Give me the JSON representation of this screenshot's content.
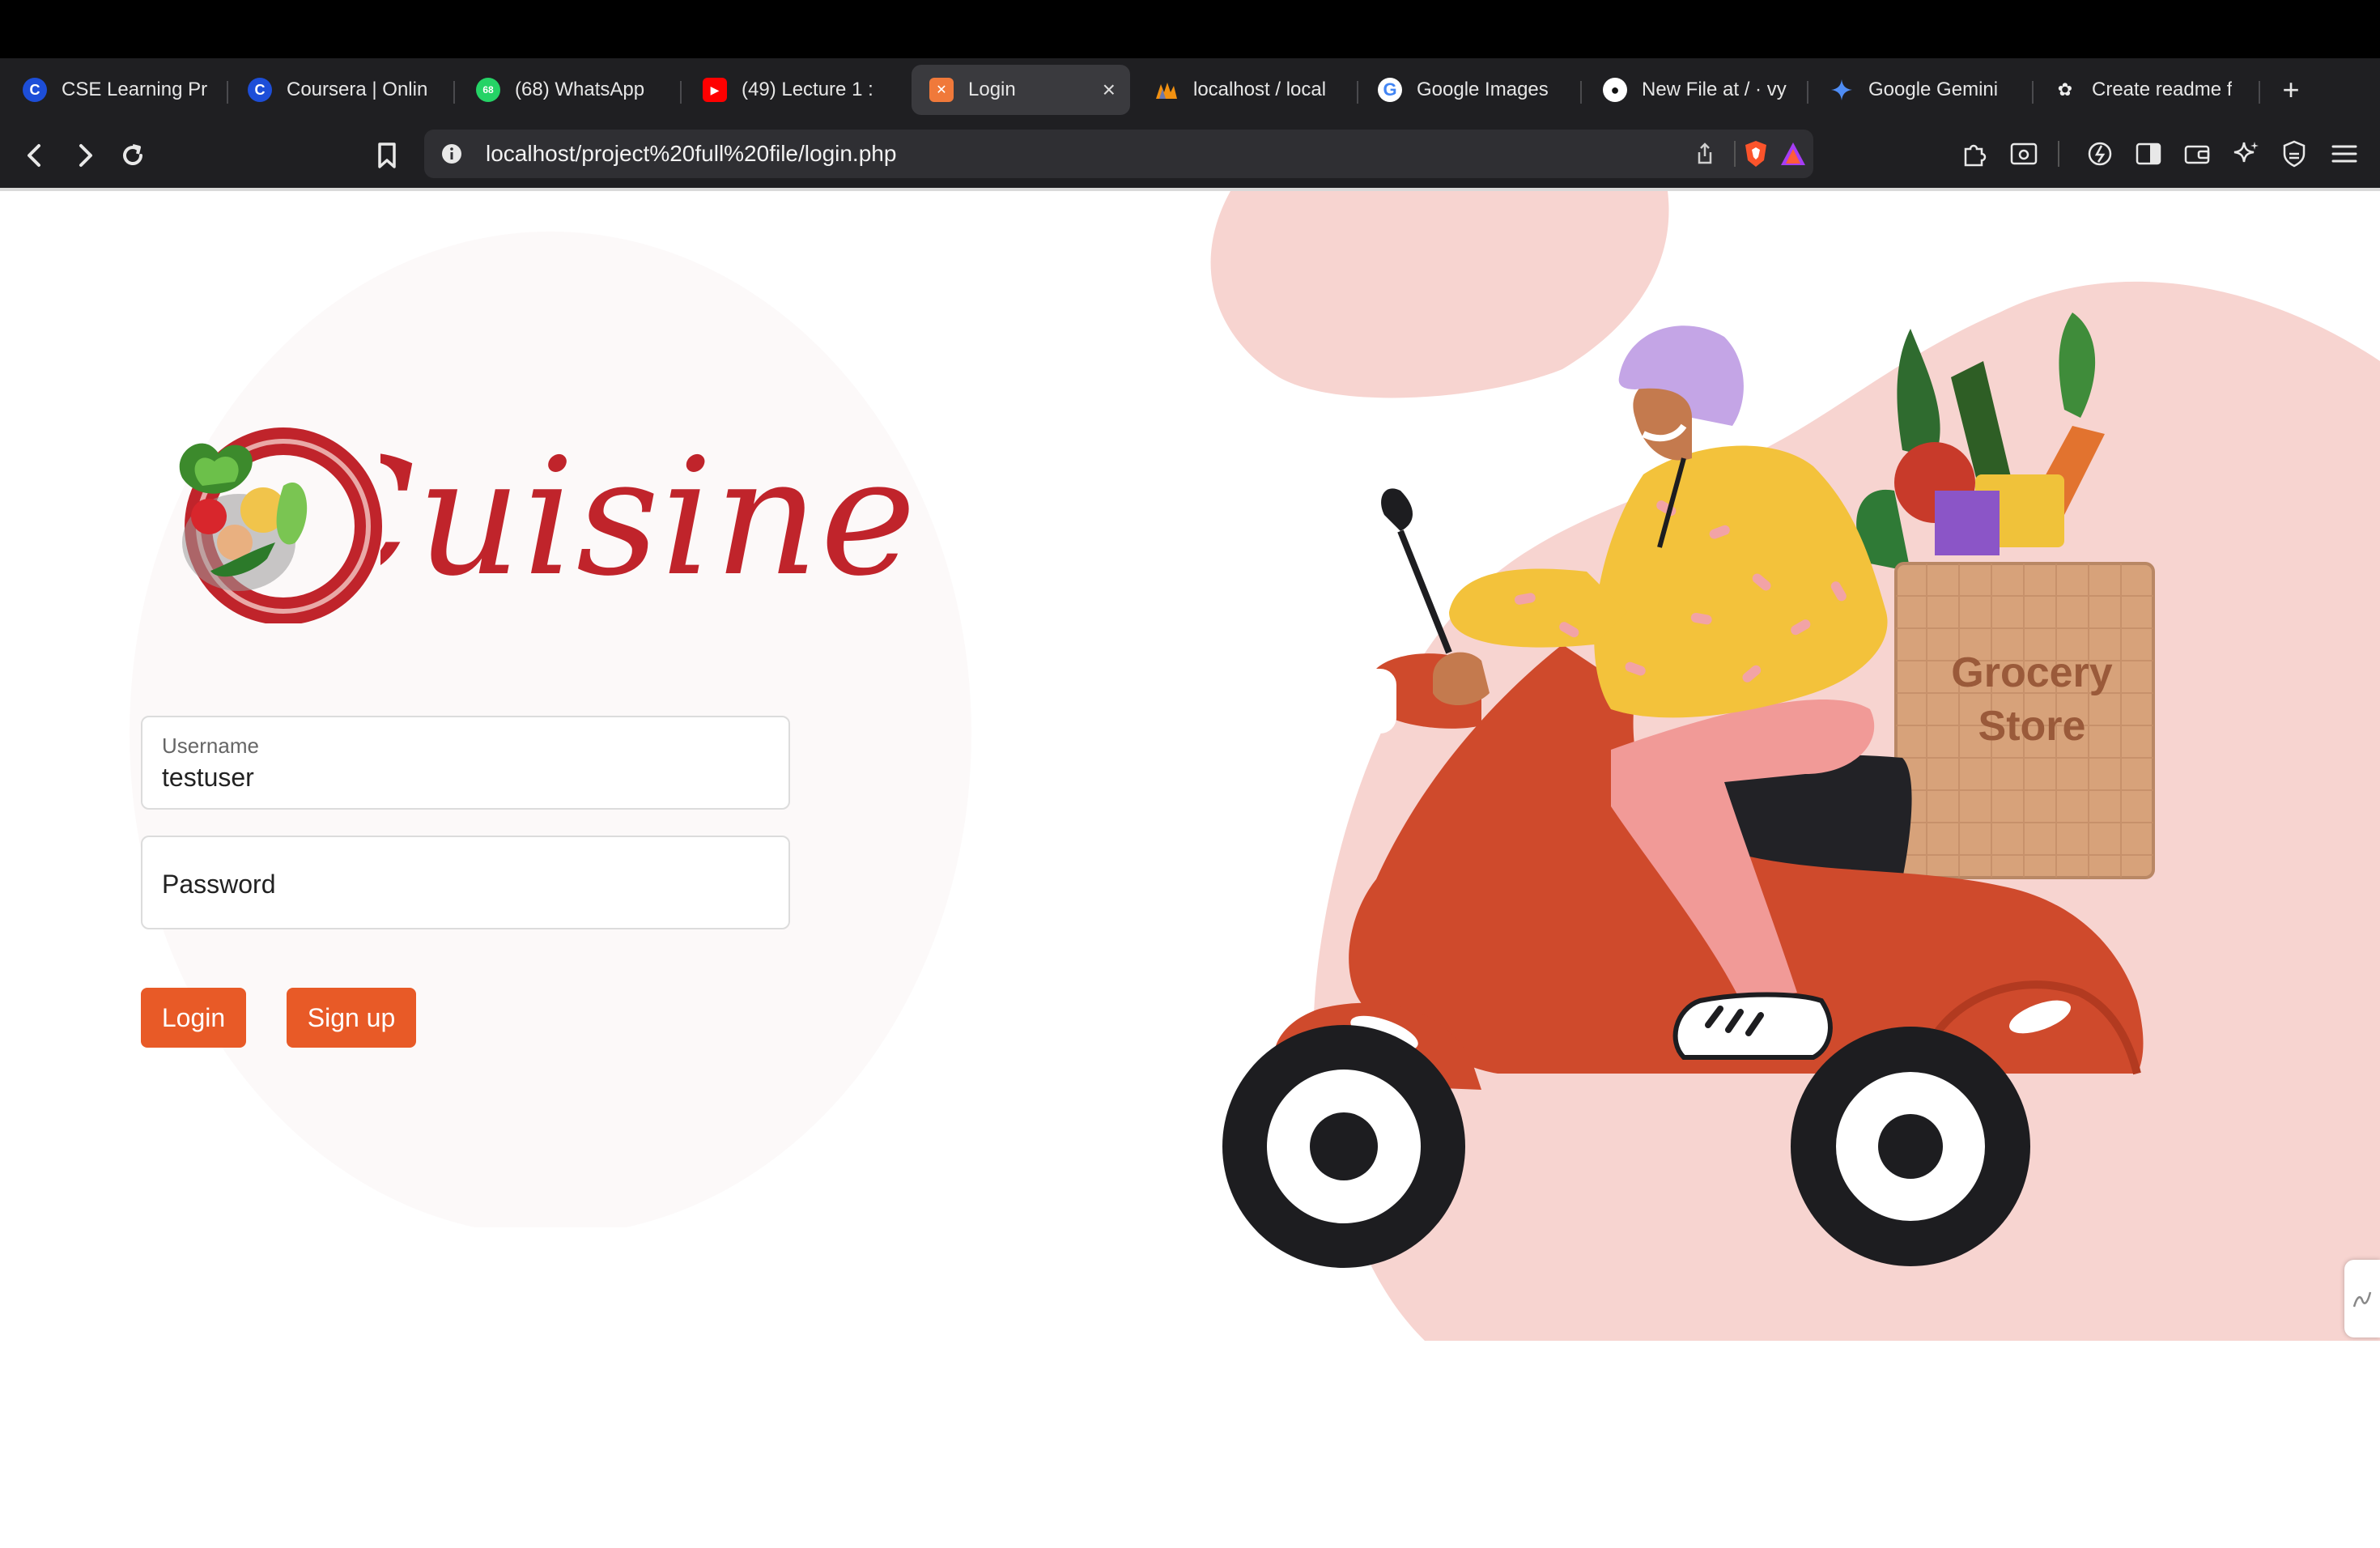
{
  "browser": {
    "tabs": [
      {
        "label": "CSE Learning Pr",
        "icon": "coursera-icon",
        "active": false
      },
      {
        "label": "Coursera | Onlin",
        "icon": "coursera-icon",
        "active": false
      },
      {
        "label": "(68) WhatsApp",
        "icon": "whatsapp-icon",
        "active": false
      },
      {
        "label": "(49) Lecture 1 :",
        "icon": "youtube-icon",
        "active": false
      },
      {
        "label": "Login",
        "icon": "xampp-icon",
        "active": true
      },
      {
        "label": "localhost / local",
        "icon": "phpmyadmin-icon",
        "active": false
      },
      {
        "label": "Google Images",
        "icon": "google-icon",
        "active": false
      },
      {
        "label": "New File at / · vy",
        "icon": "github-icon",
        "active": false
      },
      {
        "label": "Google Gemini",
        "icon": "gemini-icon",
        "active": false
      },
      {
        "label": "Create readme f",
        "icon": "openai-icon",
        "active": false
      }
    ],
    "url": "localhost/project%20full%20file/login.php"
  },
  "login": {
    "logo_text": "Cuisine",
    "username_label": "Username",
    "username_value": "testuser",
    "password_placeholder": "Password",
    "login_button": "Login",
    "signup_button": "Sign up"
  },
  "illustration": {
    "bag_text_line1": "Grocery",
    "bag_text_line2": "Store"
  },
  "colors": {
    "accent": "#e85a27",
    "logo_red": "#c0242b",
    "blob_pink": "#f7d4d0",
    "scooter_red": "#cf4a2c"
  }
}
